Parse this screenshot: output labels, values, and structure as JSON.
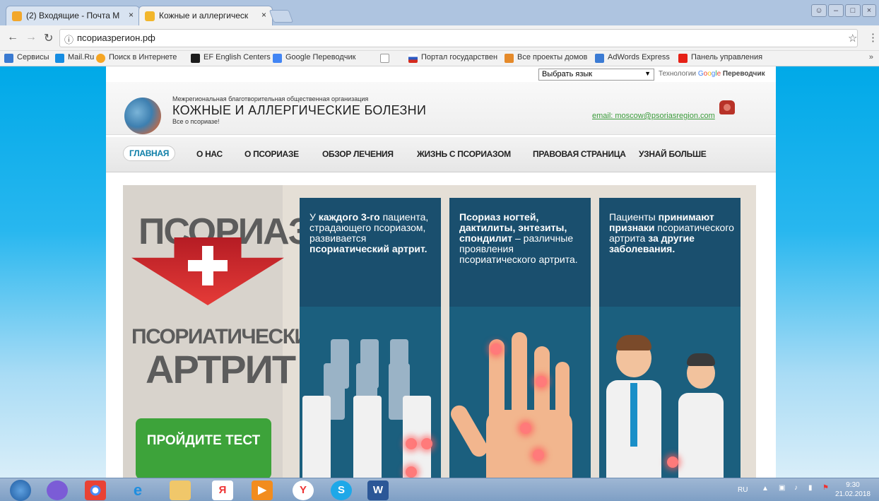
{
  "tabs": [
    {
      "title": "(2) Входящие - Почта M",
      "close": "×",
      "active": false
    },
    {
      "title": "Кожные и аллергическ",
      "close": "×",
      "active": true
    }
  ],
  "address": {
    "url": "псориазрегион.рф",
    "info_icon": "ⓘ"
  },
  "bookmarks": [
    {
      "label": "Сервисы",
      "icon": "apps-icon",
      "color": "#3a7ad1"
    },
    {
      "label": "Mail.Ru",
      "icon": "mailru-icon",
      "color": "#168de2"
    },
    {
      "label": "Поиск в Интернете",
      "icon": "search-icon",
      "color": "#f6a623"
    },
    {
      "label": "EF English Centers",
      "icon": "ef-icon",
      "color": "#1c1c1c"
    },
    {
      "label": "Google Переводчик",
      "icon": "translate-icon",
      "color": "#4285f4"
    },
    {
      "label": "",
      "icon": "page-icon",
      "color": "#999999"
    },
    {
      "label": "Портал государствен",
      "icon": "russia-flag-icon",
      "color": "#d52b1e"
    },
    {
      "label": "Все проекты домов",
      "icon": "house-icon",
      "color": "#e58a2a"
    },
    {
      "label": "AdWords Express",
      "icon": "adwords-icon",
      "color": "#3b7bd4"
    },
    {
      "label": "Панель управления",
      "icon": "youtube-icon",
      "color": "#e62117"
    }
  ],
  "bookmarks_more": "»",
  "translate": {
    "select_label": "Выбрать язык",
    "powered_prefix": "Технологии",
    "google": "Google",
    "product": "Переводчик"
  },
  "header": {
    "org": "Межрегиональная благотворительная общественная организация",
    "site_name": "КОЖНЫЕ И АЛЛЕРГИЧЕСКИЕ БОЛЕЗНИ",
    "motto": "Все о псориазе!",
    "email": "email: moscow@psoriasregion.com"
  },
  "nav": [
    {
      "label": "ГЛАВНАЯ",
      "active": true
    },
    {
      "label": "О НАС",
      "active": false
    },
    {
      "label": "О ПСОРИАЗЕ",
      "active": false
    },
    {
      "label": "ОБЗОР ЛЕЧЕНИЯ",
      "active": false
    },
    {
      "label": "ЖИЗНЬ С ПСОРИАЗОМ",
      "active": false
    },
    {
      "label": "ПРАВОВАЯ СТРАНИЦА",
      "active": false
    },
    {
      "label": "УЗНАЙ БОЛЬШЕ",
      "active": false
    }
  ],
  "banner": {
    "title1": "ПСОРИАЗ",
    "title2": "ПСОРИАТИЧЕСКИЙ",
    "title3": "АРТРИТ",
    "test_button": "ПРОЙДИТЕ ТЕСТ",
    "cards": [
      {
        "p1": "У ",
        "b1": "каждого 3-го",
        "p2": " пациента, страдающего псориазом, развивается ",
        "b2": "псориатический артрит."
      },
      {
        "b1": "Псориаз ногтей, дактилиты, энтезиты, спондилит",
        "p1": " – различные проявления псориатического артрита."
      },
      {
        "p1": "Пациенты ",
        "b1": "принимают признаки",
        "p2": " псориатического артрита ",
        "b2": "за другие заболевания."
      }
    ]
  },
  "taskbar": {
    "apps": [
      "Я",
      "Y",
      "S",
      "W"
    ],
    "lang": "RU",
    "time": "9:30",
    "date": "21.02.2018"
  },
  "colors": {
    "accent": "#1b5f7e",
    "green": "#3da33a",
    "red": "#e53b38",
    "email": "#3a9b3a"
  }
}
